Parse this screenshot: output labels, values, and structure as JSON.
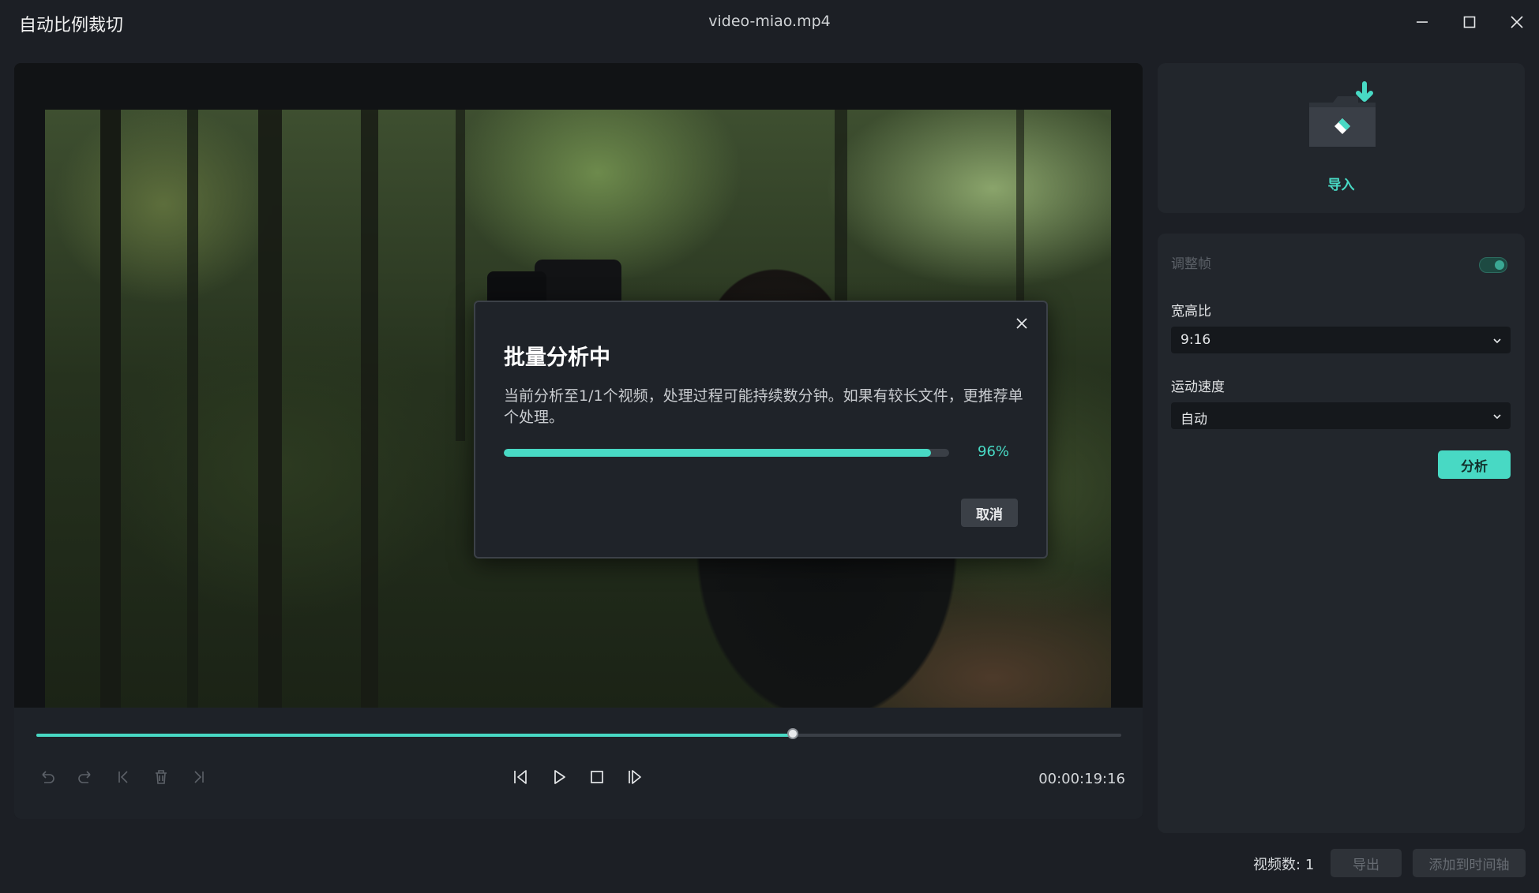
{
  "window": {
    "app_title": "自动比例裁切",
    "file_title": "video-miao.mp4"
  },
  "player": {
    "seek_progress": 0.697,
    "timecode": "00:00:19:16"
  },
  "dialog": {
    "title": "批量分析中",
    "message": "当前分析至1/1个视频，处理过程可能持续数分钟。如果有较长文件，更推荐单个处理。",
    "progress_fraction": 0.96,
    "progress_text": "96%",
    "cancel_label": "取消"
  },
  "import_panel": {
    "label": "导入"
  },
  "settings": {
    "adjust_frame_label": "调整帧",
    "adjust_frame_enabled": true,
    "aspect_label": "宽高比",
    "aspect_value": "9:16",
    "speed_label": "运动速度",
    "speed_value": "自动",
    "analyze_label": "分析"
  },
  "footer": {
    "count_label": "视频数:",
    "count_value": "1",
    "export_label": "导出",
    "add_timeline_label": "添加到时间轴"
  },
  "colors": {
    "accent": "#48d9c4",
    "background": "#1c1f25",
    "panel": "#22262c"
  }
}
